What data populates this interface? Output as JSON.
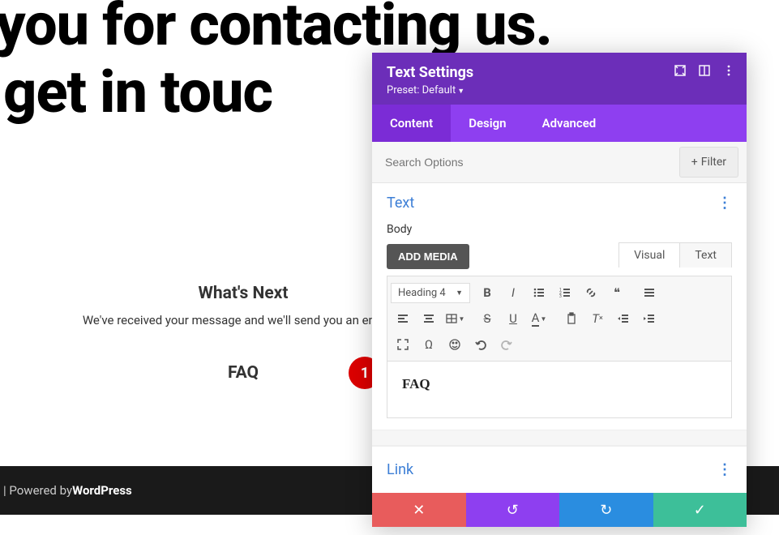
{
  "page": {
    "title_line1": "k you for contacting us.",
    "title_line2": "'ll get in touc",
    "whats_next_heading": "What's Next",
    "whats_next_body": "We've received your message and we'll send you an email w",
    "faq_heading": "FAQ",
    "footer_prefix": " | Powered by ",
    "footer_brand": "WordPress"
  },
  "marker": {
    "number": "1"
  },
  "panel": {
    "title": "Text Settings",
    "preset": "Preset: Default",
    "tabs": {
      "content": "Content",
      "design": "Design",
      "advanced": "Advanced"
    },
    "search": {
      "placeholder": "Search Options",
      "filter": "Filter"
    },
    "sections": {
      "text": {
        "title": "Text",
        "body_label": "Body",
        "add_media": "ADD MEDIA",
        "editor_tabs": {
          "visual": "Visual",
          "text": "Text"
        },
        "heading_select": "Heading 4",
        "content": "FAQ"
      },
      "link": {
        "title": "Link"
      }
    }
  }
}
